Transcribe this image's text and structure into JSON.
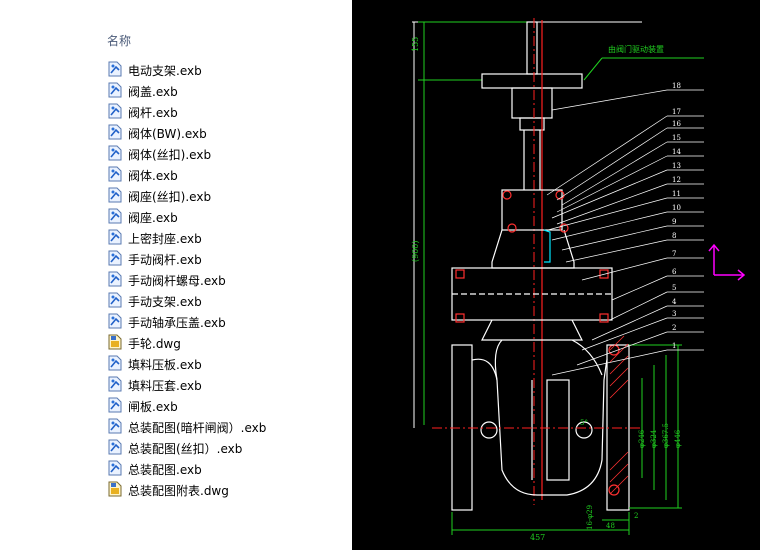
{
  "file_pane": {
    "column_header": "名称",
    "files": [
      {
        "name": "电动支架.exb",
        "icon": "exb-file-icon"
      },
      {
        "name": "阀盖.exb",
        "icon": "exb-file-icon"
      },
      {
        "name": "阀杆.exb",
        "icon": "exb-file-icon"
      },
      {
        "name": "阀体(BW).exb",
        "icon": "exb-file-icon"
      },
      {
        "name": "阀体(丝扣).exb",
        "icon": "exb-file-icon"
      },
      {
        "name": "阀体.exb",
        "icon": "exb-file-icon"
      },
      {
        "name": "阀座(丝扣).exb",
        "icon": "exb-file-icon"
      },
      {
        "name": "阀座.exb",
        "icon": "exb-file-icon"
      },
      {
        "name": "上密封座.exb",
        "icon": "exb-file-icon"
      },
      {
        "name": "手动阀杆.exb",
        "icon": "exb-file-icon"
      },
      {
        "name": "手动阀杆螺母.exb",
        "icon": "exb-file-icon"
      },
      {
        "name": "手动支架.exb",
        "icon": "exb-file-icon"
      },
      {
        "name": "手动轴承压盖.exb",
        "icon": "exb-file-icon"
      },
      {
        "name": "手轮.dwg",
        "icon": "dwg-file-icon"
      },
      {
        "name": "填料压板.exb",
        "icon": "exb-file-icon"
      },
      {
        "name": "填料压套.exb",
        "icon": "exb-file-icon"
      },
      {
        "name": "闸板.exb",
        "icon": "exb-file-icon"
      },
      {
        "name": "总装配图(暗杆闸阀）.exb",
        "icon": "exb-file-icon"
      },
      {
        "name": "总装配图(丝扣）.exb",
        "icon": "exb-file-icon"
      },
      {
        "name": "总装配图.exb",
        "icon": "exb-file-icon"
      },
      {
        "name": "总装配图附表.dwg",
        "icon": "dwg-file-icon"
      }
    ]
  },
  "cad_preview": {
    "annotation_note": "由阀门驱动装置",
    "part_numbers": [
      "18",
      "17",
      "16",
      "15",
      "14",
      "13",
      "12",
      "11",
      "10",
      "9",
      "8",
      "7",
      "6",
      "5",
      "4",
      "3",
      "2",
      "1"
    ],
    "dimensions": {
      "top_height": "155",
      "total_height": "(900)",
      "width_bottom": "457",
      "flange_offset": "48",
      "bolt_note": "16-φ29",
      "small_dim": "2",
      "diameters": [
        "φ246",
        "φ324",
        "φ367.5",
        "φ446"
      ],
      "angle": "5°"
    },
    "colors": {
      "background": "#000000",
      "outline": "#ffffff",
      "centerline": "#ff2020",
      "dimension": "#20d020",
      "hatch": "#ff3030",
      "ucs_axis": "#ff00ff",
      "accent": "#00e5ff"
    }
  }
}
